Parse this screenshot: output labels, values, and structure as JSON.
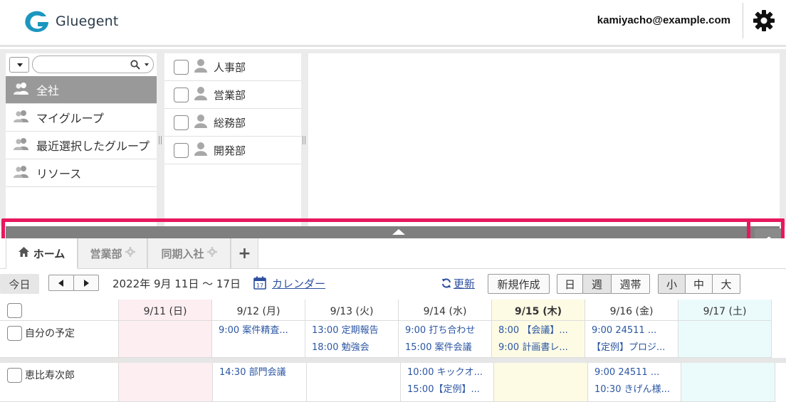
{
  "header": {
    "logo_text": "Gluegent",
    "user_email": "kamiyacho@example.com"
  },
  "groups": [
    {
      "label": "全社",
      "selected": true
    },
    {
      "label": "マイグループ",
      "selected": false
    },
    {
      "label": "最近選択したグループ",
      "selected": false
    },
    {
      "label": "リソース",
      "selected": false
    }
  ],
  "departments": [
    "人事部",
    "営業部",
    "総務部",
    "開発部"
  ],
  "tabs": [
    {
      "label": "ホーム",
      "icon": "home-icon",
      "active": true
    },
    {
      "label": "営業部",
      "icon": "gear-icon",
      "active": false
    },
    {
      "label": "同期入社",
      "icon": "gear-icon",
      "active": false
    },
    {
      "label": "+",
      "icon": "plus-icon",
      "active": false
    }
  ],
  "toolbar": {
    "today": "今日",
    "range": "2022年 9月 11日 ～ 17日",
    "calendar_link": "カレンダー",
    "refresh": "更新",
    "new": "新規作成",
    "view_day": "日",
    "view_week": "週",
    "view_weekly": "週帯",
    "size_small": "小",
    "size_medium": "中",
    "size_large": "大"
  },
  "calendar": {
    "days": [
      "9/11 (日)",
      "9/12 (月)",
      "9/13 (火)",
      "9/14 (水)",
      "9/15 (木)",
      "9/16 (金)",
      "9/17 (土)"
    ],
    "rows": [
      {
        "name": "自分の予定",
        "events": [
          [],
          [
            "9:00 案件精査..."
          ],
          [
            "13:00 定期報告",
            "18:00 勉強会"
          ],
          [
            "9:00 打ち合わせ",
            "15:00 案件会議"
          ],
          [
            "8:00 【会議】...",
            "9:00 計画書レ..."
          ],
          [
            "9:00 24511 ...",
            "【定例】プロジ..."
          ],
          []
        ]
      },
      {
        "name": "恵比寿次郎",
        "events": [
          [],
          [
            "14:30 部門会議"
          ],
          [],
          [
            "10:00 キックオ...",
            "15:00【定例】..."
          ],
          [],
          [
            "9:00 24511 ...",
            "10:30 きげん様..."
          ],
          []
        ]
      }
    ]
  },
  "colors": {
    "highlight": "#e8175d",
    "link": "#2c4f9e",
    "selected_group": "#999999",
    "sunday_bg": "#fdeef2",
    "today_bg": "#fdfbe4",
    "saturday_bg": "#ebfbfc"
  }
}
